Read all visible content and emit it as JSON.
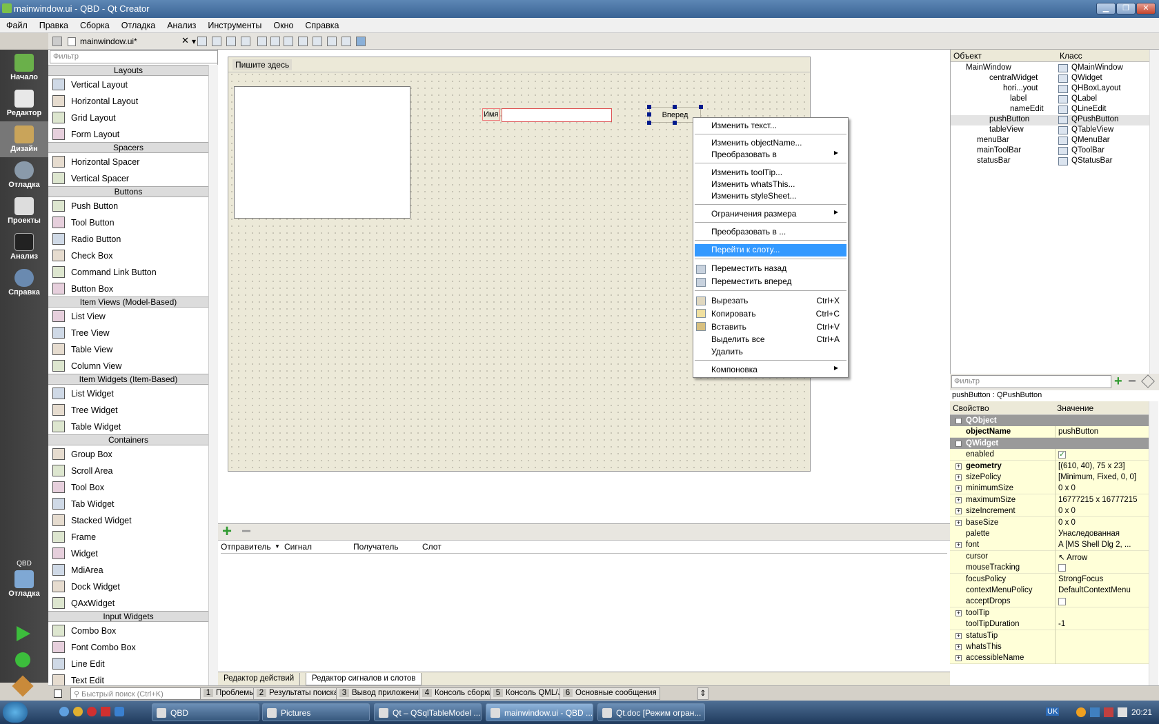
{
  "window": {
    "title": "mainwindow.ui - QBD - Qt Creator",
    "minimize": "▁",
    "maximize": "❐",
    "close": "✕"
  },
  "menu": [
    "Файл",
    "Правка",
    "Сборка",
    "Отладка",
    "Анализ",
    "Инструменты",
    "Окно",
    "Справка"
  ],
  "editor_tab": {
    "filename": "mainwindow.ui*",
    "close": "✕",
    "dropdown": "▾"
  },
  "modes": [
    "Начало",
    "Редактор",
    "Дизайн",
    "Отладка",
    "Проекты",
    "Анализ",
    "Справка"
  ],
  "target": {
    "project": "QBD",
    "config": "Отладка"
  },
  "widgetbox": {
    "filter_placeholder": "Фильтр",
    "categories": [
      {
        "name": "Layouts",
        "items": [
          "Vertical Layout",
          "Horizontal Layout",
          "Grid Layout",
          "Form Layout"
        ]
      },
      {
        "name": "Spacers",
        "items": [
          "Horizontal Spacer",
          "Vertical Spacer"
        ]
      },
      {
        "name": "Buttons",
        "items": [
          "Push Button",
          "Tool Button",
          "Radio Button",
          "Check Box",
          "Command Link Button",
          "Button Box"
        ]
      },
      {
        "name": "Item Views (Model-Based)",
        "items": [
          "List View",
          "Tree View",
          "Table View",
          "Column View"
        ]
      },
      {
        "name": "Item Widgets (Item-Based)",
        "items": [
          "List Widget",
          "Tree Widget",
          "Table Widget"
        ]
      },
      {
        "name": "Containers",
        "items": [
          "Group Box",
          "Scroll Area",
          "Tool Box",
          "Tab Widget",
          "Stacked Widget",
          "Frame",
          "Widget",
          "MdiArea",
          "Dock Widget",
          "QAxWidget"
        ]
      },
      {
        "name": "Input Widgets",
        "items": [
          "Combo Box",
          "Font Combo Box",
          "Line Edit",
          "Text Edit"
        ]
      }
    ]
  },
  "form": {
    "menu_placeholder": "Пишите здесь",
    "label": "Имя",
    "button": "Вперед"
  },
  "context_menu": {
    "edit_text": "Изменить текст...",
    "edit_objectname": "Изменить objectName...",
    "morph": "Преобразовать в",
    "edit_tooltip": "Изменить toolTip...",
    "edit_whatsthis": "Изменить whatsThis...",
    "edit_stylesheet": "Изменить styleSheet...",
    "size_constraints": "Ограничения размера",
    "promote": "Преобразовать в ...",
    "goto_slot": "Перейти к слоту...",
    "send_back": "Переместить назад",
    "bring_front": "Переместить вперед",
    "cut": "Вырезать",
    "cut_sc": "Ctrl+X",
    "copy": "Копировать",
    "copy_sc": "Ctrl+C",
    "paste": "Вставить",
    "paste_sc": "Ctrl+V",
    "select_all": "Выделить все",
    "select_all_sc": "Ctrl+A",
    "delete": "Удалить",
    "layout": "Компоновка",
    "submenu_arrow": "▶"
  },
  "signals": {
    "add": "+",
    "remove": "−",
    "col_sender": "Отправитель",
    "col_signal": "Сигнал",
    "col_receiver": "Получатель",
    "col_slot": "Слот",
    "tab_actions": "Редактор действий",
    "tab_signals": "Редактор сигналов и слотов"
  },
  "object_inspector": {
    "col_object": "Объект",
    "col_class": "Класс",
    "rows": [
      {
        "obj": "MainWindow",
        "cls": "QMainWindow"
      },
      {
        "obj": "centralWidget",
        "cls": "QWidget"
      },
      {
        "obj": "hori...yout",
        "cls": "QHBoxLayout"
      },
      {
        "obj": "label",
        "cls": "QLabel"
      },
      {
        "obj": "nameEdit",
        "cls": "QLineEdit"
      },
      {
        "obj": "pushButton",
        "cls": "QPushButton"
      },
      {
        "obj": "tableView",
        "cls": "QTableView"
      },
      {
        "obj": "menuBar",
        "cls": "QMenuBar"
      },
      {
        "obj": "mainToolBar",
        "cls": "QToolBar"
      },
      {
        "obj": "statusBar",
        "cls": "QStatusBar"
      }
    ]
  },
  "property_editor": {
    "filter_placeholder": "Фильтр",
    "selected": "pushButton : QPushButton",
    "col_property": "Свойство",
    "col_value": "Значение",
    "rows": [
      {
        "name": "QObject",
        "value": "",
        "group": true
      },
      {
        "name": "objectName",
        "value": "pushButton",
        "bold": true
      },
      {
        "name": "QWidget",
        "value": "",
        "group": true
      },
      {
        "name": "enabled",
        "value": "✓",
        "check": true
      },
      {
        "name": "geometry",
        "value": "[(610, 40), 75 x 23]",
        "bold": true,
        "expand": true
      },
      {
        "name": "sizePolicy",
        "value": "[Minimum, Fixed, 0, 0]",
        "expand": true
      },
      {
        "name": "minimumSize",
        "value": "0 x 0",
        "expand": true
      },
      {
        "name": "maximumSize",
        "value": "16777215 x 16777215",
        "expand": true
      },
      {
        "name": "sizeIncrement",
        "value": "0 x 0",
        "expand": true
      },
      {
        "name": "baseSize",
        "value": "0 x 0",
        "expand": true
      },
      {
        "name": "palette",
        "value": "Унаследованная"
      },
      {
        "name": "font",
        "value": "A  [MS Shell Dlg 2, ...",
        "expand": true
      },
      {
        "name": "cursor",
        "value": "↖  Arrow"
      },
      {
        "name": "mouseTracking",
        "value": "",
        "check": true
      },
      {
        "name": "focusPolicy",
        "value": "StrongFocus"
      },
      {
        "name": "contextMenuPolicy",
        "value": "DefaultContextMenu"
      },
      {
        "name": "acceptDrops",
        "value": "",
        "check": true
      },
      {
        "name": "toolTip",
        "value": "",
        "expand": true
      },
      {
        "name": "toolTipDuration",
        "value": "-1"
      },
      {
        "name": "statusTip",
        "value": "",
        "expand": true
      },
      {
        "name": "whatsThis",
        "value": "",
        "expand": true
      },
      {
        "name": "accessibleName",
        "value": "",
        "expand": true
      }
    ]
  },
  "statusbar": {
    "locator_placeholder": "Быстрый поиск (Ctrl+K)",
    "panes": [
      {
        "n": "1",
        "label": "Проблемы"
      },
      {
        "n": "2",
        "label": "Результаты поиска"
      },
      {
        "n": "3",
        "label": "Вывод приложения"
      },
      {
        "n": "4",
        "label": "Консоль сборки"
      },
      {
        "n": "5",
        "label": "Консоль QML/JS"
      },
      {
        "n": "6",
        "label": "Основные сообщения"
      }
    ]
  },
  "taskbar": {
    "tasks": [
      "QBD",
      "Pictures",
      "Qt – QSqlTableModel ...",
      "mainwindow.ui - QBD ...",
      "Qt.doc [Режим огран..."
    ],
    "lang": "UK",
    "time": "20:21"
  }
}
